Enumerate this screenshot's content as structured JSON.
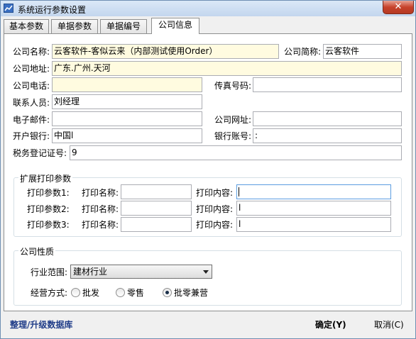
{
  "window": {
    "title": "系统运行参数设置",
    "close_label": "✕"
  },
  "tabs": [
    {
      "label": "基本参数"
    },
    {
      "label": "单据参数"
    },
    {
      "label": "单据编号"
    },
    {
      "label": "公司信息"
    }
  ],
  "company": {
    "name": {
      "label": "公司名称:",
      "value": "云客软件-客似云来（内部测试使用Order）"
    },
    "short_name": {
      "label": "公司简称:",
      "value": "云客软件"
    },
    "address": {
      "label": "公司地址:",
      "value": "广东.广州.天河"
    },
    "phone": {
      "label": "公司电话:",
      "value": ""
    },
    "fax": {
      "label": "传真号码:",
      "value": ""
    },
    "contact": {
      "label": "联系人员:",
      "value": "刘经理"
    },
    "email": {
      "label": "电子邮件:",
      "value": ""
    },
    "website": {
      "label": "公司网址:",
      "value": ""
    },
    "bank": {
      "label": "开户银行:",
      "value": "中国l"
    },
    "account": {
      "label": "银行账号:",
      "value": ":"
    },
    "tax": {
      "label": "税务登记证号:",
      "value": "9"
    }
  },
  "print_group": {
    "title": "扩展打印参数",
    "name_label": "打印名称:",
    "content_label": "打印内容:",
    "rows": [
      {
        "label": "打印参数1:",
        "name": "",
        "content": ""
      },
      {
        "label": "打印参数2:",
        "name": "",
        "content": "l"
      },
      {
        "label": "打印参数3:",
        "name": "",
        "content": "l"
      }
    ]
  },
  "nature_group": {
    "title": "公司性质",
    "industry_label": "行业范围:",
    "industry_value": "建材行业",
    "mode_label": "经营方式:",
    "modes": [
      {
        "label": "批发",
        "selected": false
      },
      {
        "label": "零售",
        "selected": false
      },
      {
        "label": "批零兼营",
        "selected": true
      }
    ]
  },
  "footer": {
    "upgrade_label": "整理/升级数据库",
    "ok_label": "确定(Y)",
    "cancel_label": "取消(C)"
  }
}
